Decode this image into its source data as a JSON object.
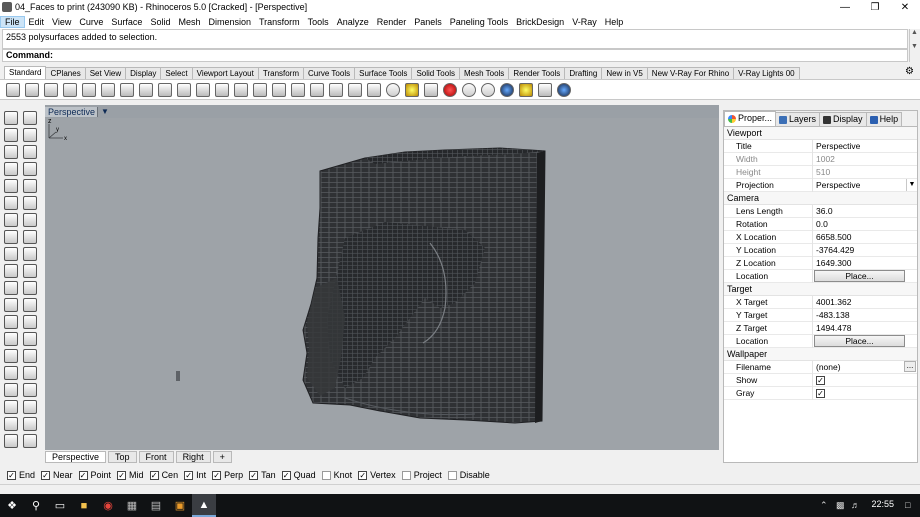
{
  "window": {
    "title": "04_Faces to print (243090 KB) - Rhinoceros 5.0 [Cracked] - [Perspective]",
    "minimize_icon": "minimize-icon",
    "maximize_icon": "restore-icon",
    "close_icon": "close-icon"
  },
  "menu": [
    "File",
    "Edit",
    "View",
    "Curve",
    "Surface",
    "Solid",
    "Mesh",
    "Dimension",
    "Transform",
    "Tools",
    "Analyze",
    "Render",
    "Panels",
    "Paneling Tools",
    "BrickDesign",
    "V-Ray",
    "Help"
  ],
  "history": {
    "line": "2553 polysurfaces added to selection."
  },
  "command": {
    "label": "Command:",
    "value": ""
  },
  "toolbar_tabs": [
    "Standard",
    "CPlanes",
    "Set View",
    "Display",
    "Select",
    "Viewport Layout",
    "Transform",
    "Curve Tools",
    "Surface Tools",
    "Solid Tools",
    "Mesh Tools",
    "Render Tools",
    "Drafting",
    "New in V5",
    "New V-Ray For Rhino",
    "V-Ray Lights 00"
  ],
  "toolbar_icons": [
    "new-file-icon",
    "open-icon",
    "save-icon",
    "print-icon",
    "import-icon",
    "cut-icon",
    "copy-icon",
    "paste-icon",
    "undo-icon",
    "pan-icon",
    "move-view-icon",
    "zoom-extents-icon",
    "zoom-window-icon",
    "zoom-selected-icon",
    "zoom-dynamic-icon",
    "rotate-view-icon",
    "four-viewports-icon",
    "select-car-icon",
    "hide-icon",
    "show-icon",
    "shade-icon",
    "light-bulb-icon",
    "lock-icon",
    "color-sphere-icon",
    "render-sphere-icon",
    "material-sphere-icon",
    "environment-sphere-icon",
    "sun-icon",
    "gears-icon",
    "help-icon"
  ],
  "left_tools": [
    "select-arrow-icon",
    "point-cloud-icon",
    "polyline-icon",
    "arc-point-icon",
    "circle-icon",
    "eye-icon",
    "triangle-icon",
    "rectangle-icon",
    "ellipse-icon",
    "curve-icon",
    "text-icon",
    "fillet-icon",
    "surface-patch-icon",
    "surface-loft-icon",
    "box-solid-icon",
    "sphere-solid-icon",
    "cylinder-mesh-icon",
    "gear-mesh-icon",
    "explode-icon",
    "lightning-icon",
    "trim-icon",
    "split-icon",
    "array-icon",
    "join-icon",
    "boolean-icon",
    "offset-icon",
    "move-icon",
    "mirror-icon",
    "copy-tool-icon",
    "rotate-tool-icon",
    "scale-icon",
    "align-icon",
    "group-icon",
    "ungroup-icon",
    "dimension-icon",
    "grid-snap-icon",
    "checkmark-icon",
    "history-icon",
    "analysis-icon",
    "render-icon"
  ],
  "viewport": {
    "active_label": "Perspective",
    "menu_arrow": "chevron-down-icon",
    "axis_z": "z",
    "axis_y": "y",
    "axis_x": "x"
  },
  "viewport_tabs": [
    "Perspective",
    "Top",
    "Front",
    "Right",
    "+"
  ],
  "panel": {
    "tabs": [
      {
        "label": "Proper...",
        "icon": "properties-icon"
      },
      {
        "label": "Layers",
        "icon": "layers-icon"
      },
      {
        "label": "Display",
        "icon": "display-icon"
      },
      {
        "label": "Help",
        "icon": "help-book-icon"
      }
    ],
    "viewport_section": "Viewport",
    "title_k": "Title",
    "title_v": "Perspective",
    "width_k": "Width",
    "width_v": "1002",
    "height_k": "Height",
    "height_v": "510",
    "projection_k": "Projection",
    "projection_v": "Perspective",
    "camera_section": "Camera",
    "lens_k": "Lens Length",
    "lens_v": "36.0",
    "rotation_k": "Rotation",
    "rotation_v": "0.0",
    "xloc_k": "X Location",
    "xloc_v": "6658.500",
    "yloc_k": "Y Location",
    "yloc_v": "-3764.429",
    "zloc_k": "Z Location",
    "zloc_v": "1649.300",
    "location_k": "Location",
    "location_btn": "Place...",
    "target_section": "Target",
    "xt_k": "X Target",
    "xt_v": "4001.362",
    "yt_k": "Y Target",
    "yt_v": "-483.138",
    "zt_k": "Z Target",
    "zt_v": "1494.478",
    "tloc_k": "Location",
    "tloc_btn": "Place...",
    "wallpaper_section": "Wallpaper",
    "filename_k": "Filename",
    "filename_v": "(none)",
    "filename_btn": "...",
    "show_k": "Show",
    "show_checked": true,
    "gray_k": "Gray",
    "gray_checked": true
  },
  "osnaps": [
    {
      "label": "End",
      "checked": true
    },
    {
      "label": "Near",
      "checked": true
    },
    {
      "label": "Point",
      "checked": true
    },
    {
      "label": "Mid",
      "checked": true
    },
    {
      "label": "Cen",
      "checked": true
    },
    {
      "label": "Int",
      "checked": true
    },
    {
      "label": "Perp",
      "checked": true
    },
    {
      "label": "Tan",
      "checked": true
    },
    {
      "label": "Quad",
      "checked": true
    },
    {
      "label": "Knot",
      "checked": false
    },
    {
      "label": "Vertex",
      "checked": true
    },
    {
      "label": "Project",
      "checked": false
    },
    {
      "label": "Disable",
      "checked": false
    }
  ],
  "taskbar": {
    "icons": [
      "windows-start-icon",
      "search-icon",
      "task-view-icon",
      "file-explorer-icon",
      "chrome-icon",
      "photos-icon",
      "windows-store-icon",
      "illustrator-icon",
      "rhino-icon"
    ],
    "clock": "22:55",
    "tray_icons": [
      "up-arrow-icon",
      "network-icon",
      "notification-icon"
    ]
  },
  "colors": {
    "viewport_bg": "#9ea3a8",
    "model": "#2f3134",
    "model_grid": "#6a6e73",
    "accent": "#0d2a55"
  }
}
